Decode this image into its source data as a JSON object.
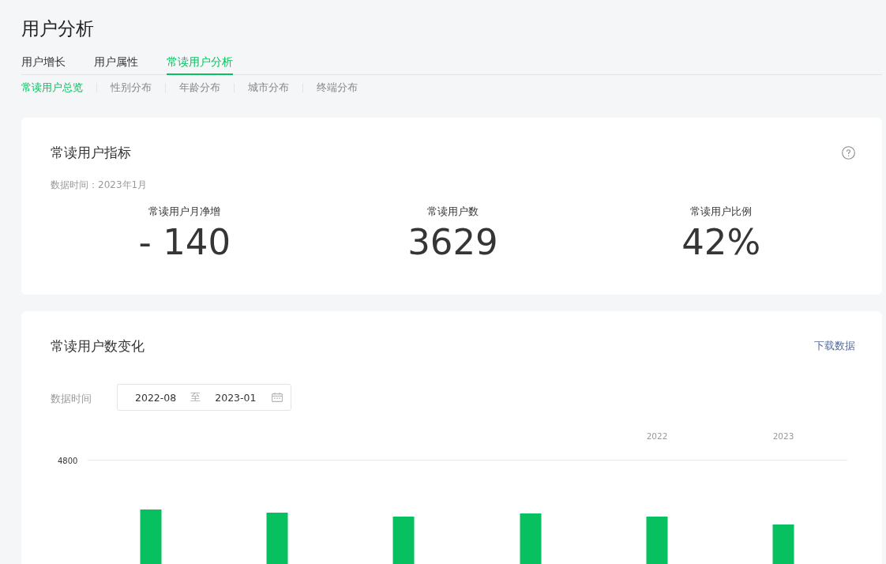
{
  "page_title": "用户分析",
  "tabs": [
    {
      "label": "用户增长",
      "selected": false
    },
    {
      "label": "用户属性",
      "selected": false
    },
    {
      "label": "常读用户分析",
      "selected": true
    }
  ],
  "sub_tabs": [
    {
      "label": "常读用户总览",
      "selected": true
    },
    {
      "label": "性别分布",
      "selected": false
    },
    {
      "label": "年龄分布",
      "selected": false
    },
    {
      "label": "城市分布",
      "selected": false
    },
    {
      "label": "终端分布",
      "selected": false
    }
  ],
  "metrics_card": {
    "title": "常读用户指标",
    "data_time": "数据时间：2023年1月",
    "metrics": [
      {
        "label": "常读用户月净增",
        "value": "- 140"
      },
      {
        "label": "常读用户数",
        "value": "3629"
      },
      {
        "label": "常读用户比例",
        "value": "42%"
      }
    ]
  },
  "trend_card": {
    "title": "常读用户数变化",
    "download_link": "下载数据",
    "date_filter": {
      "label": "数据时间",
      "start": "2022-08",
      "separator": "至",
      "end": "2023-01"
    },
    "chart": {
      "y_tick_label": "4800",
      "year_labels": [
        "2022",
        "2023"
      ]
    }
  }
}
